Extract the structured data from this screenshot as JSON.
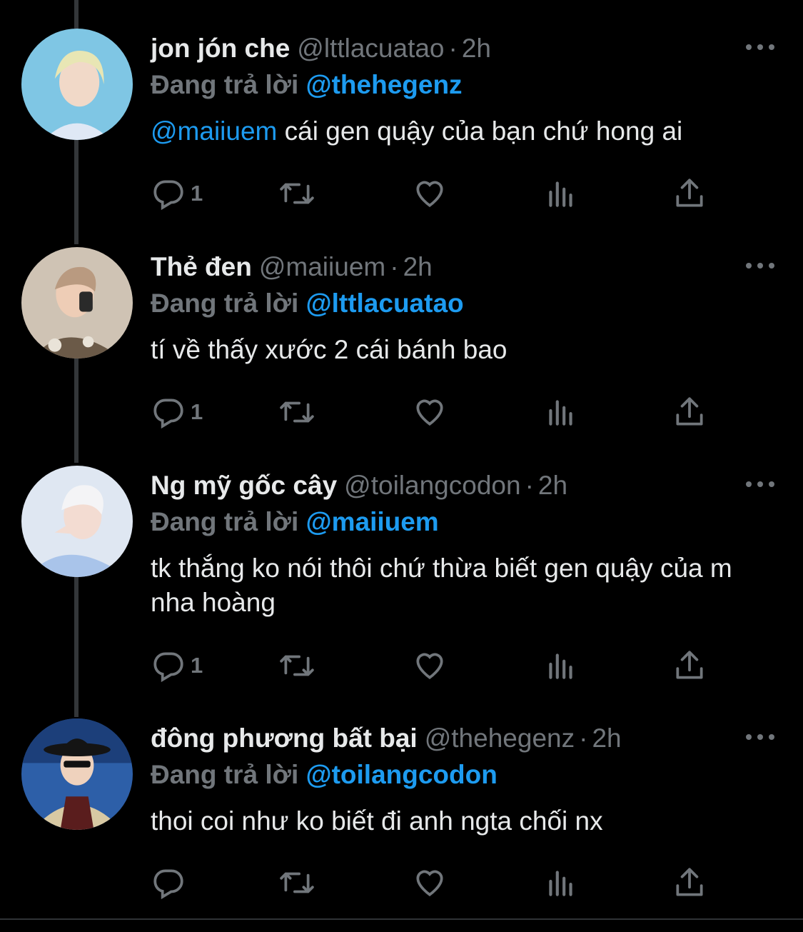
{
  "tweets": [
    {
      "name": "jon jón che",
      "handle": "@lttlacuatao",
      "time": "2h",
      "replying_prefix": "Đang trả lời",
      "replying_to": "@thehegenz",
      "body_mention": "@maiiuem",
      "body": " cái gen quậy của bạn chứ hong ai",
      "reply_count": "1"
    },
    {
      "name": "Thẻ đen",
      "handle": "@maiiuem",
      "time": "2h",
      "replying_prefix": "Đang trả lời",
      "replying_to": "@lttlacuatao",
      "body_mention": "",
      "body": "tí về thấy xước 2 cái bánh bao",
      "reply_count": "1"
    },
    {
      "name": "Ng mỹ gốc cây",
      "handle": "@toilangcodon",
      "time": "2h",
      "replying_prefix": "Đang trả lời",
      "replying_to": "@maiiuem",
      "body_mention": "",
      "body": "tk thắng ko nói thôi chứ thừa biết gen quậy của m nha hoàng",
      "reply_count": "1"
    },
    {
      "name": "đông phương bất bại",
      "handle": "@thehegenz",
      "time": "2h",
      "replying_prefix": "Đang trả lời",
      "replying_to": "@toilangcodon",
      "body_mention": "",
      "body": "thoi coi như ko biết đi anh ngta chối nx",
      "reply_count": ""
    }
  ],
  "dot_separator": "·",
  "icons": [
    "reply-icon",
    "retweet-icon",
    "like-icon",
    "views-icon",
    "share-icon",
    "more-icon"
  ],
  "colors": {
    "background": "#000000",
    "text": "#e7e9ea",
    "muted": "#71767b",
    "accent": "#1d9bf0",
    "thread_line": "#333639"
  }
}
